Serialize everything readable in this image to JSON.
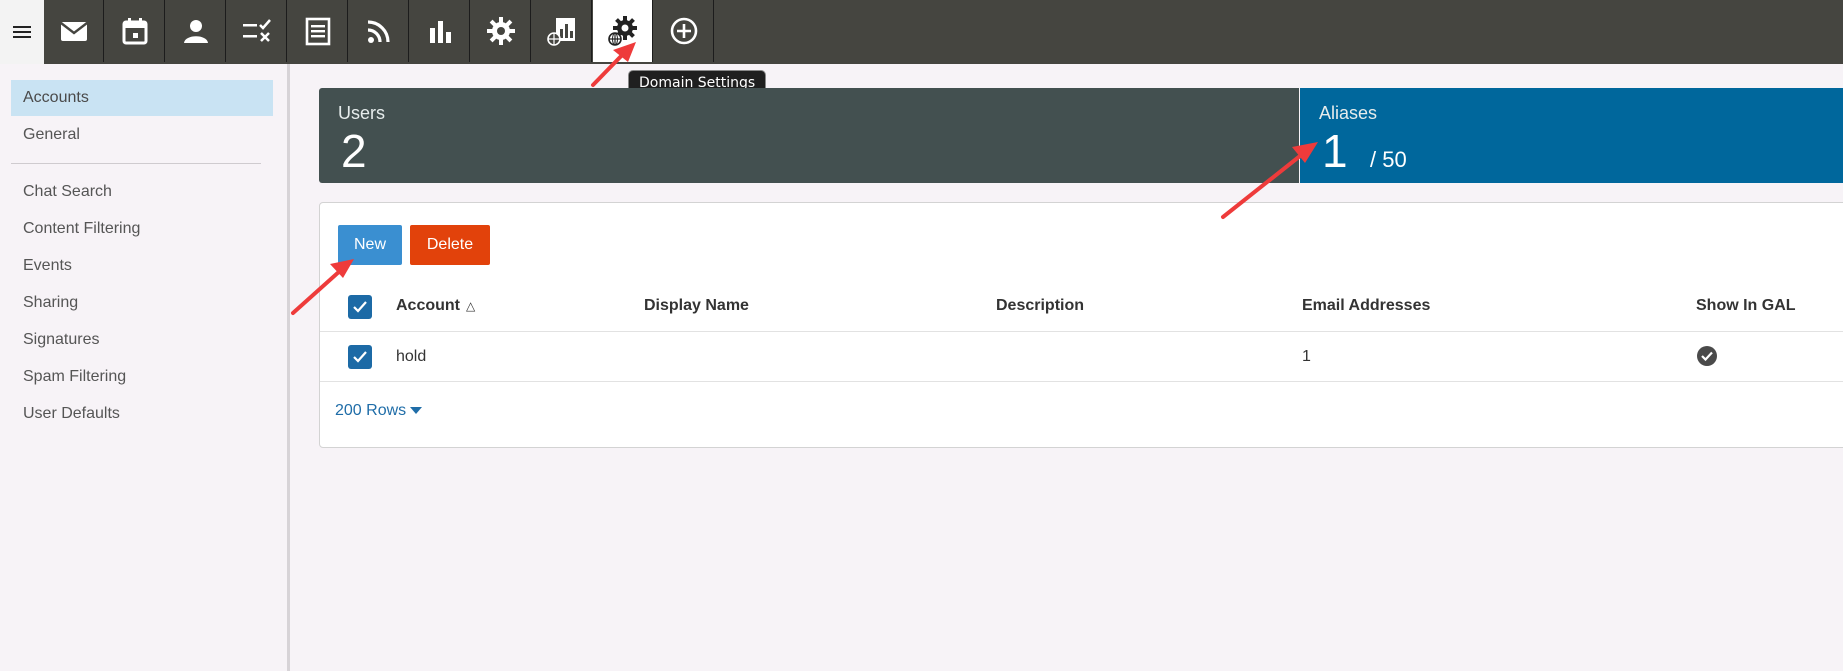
{
  "toolbar": {
    "tools": [
      "mail-icon",
      "calendar-icon",
      "contacts-icon",
      "tasks-icon",
      "notes-icon",
      "rss-icon",
      "reports-icon",
      "settings-icon",
      "domain-reports-icon",
      "domain-settings-icon",
      "add-icon"
    ],
    "active_tool": "domain-settings-icon",
    "tooltip": "Domain Settings"
  },
  "sidebar": {
    "items": [
      {
        "label": "Accounts",
        "active": true
      },
      {
        "label": "General"
      },
      {
        "label": "Chat Search"
      },
      {
        "label": "Content Filtering"
      },
      {
        "label": "Events"
      },
      {
        "label": "Sharing"
      },
      {
        "label": "Signatures"
      },
      {
        "label": "Spam Filtering"
      },
      {
        "label": "User Defaults"
      }
    ]
  },
  "stats": {
    "users": {
      "label": "Users",
      "value": "2"
    },
    "aliases": {
      "label": "Aliases",
      "value": "1",
      "max": "/ 50"
    }
  },
  "actions": {
    "new_label": "New",
    "delete_label": "Delete"
  },
  "table": {
    "columns": [
      "Account",
      "Display Name",
      "Description",
      "Email Addresses",
      "Show In GAL"
    ],
    "rows": [
      {
        "account": "hold",
        "display_name": "",
        "description": "",
        "email_addresses": "1",
        "show_in_gal": true
      }
    ]
  },
  "pagination": {
    "rows_label": "200 Rows"
  },
  "colors": {
    "toolbar_bg": "#454540",
    "users_card": "#435050",
    "aliases_card": "#00679c",
    "new_button": "#3a8fd1",
    "delete_button": "#e2420b",
    "annotation_arrow": "#ee3b3b"
  }
}
